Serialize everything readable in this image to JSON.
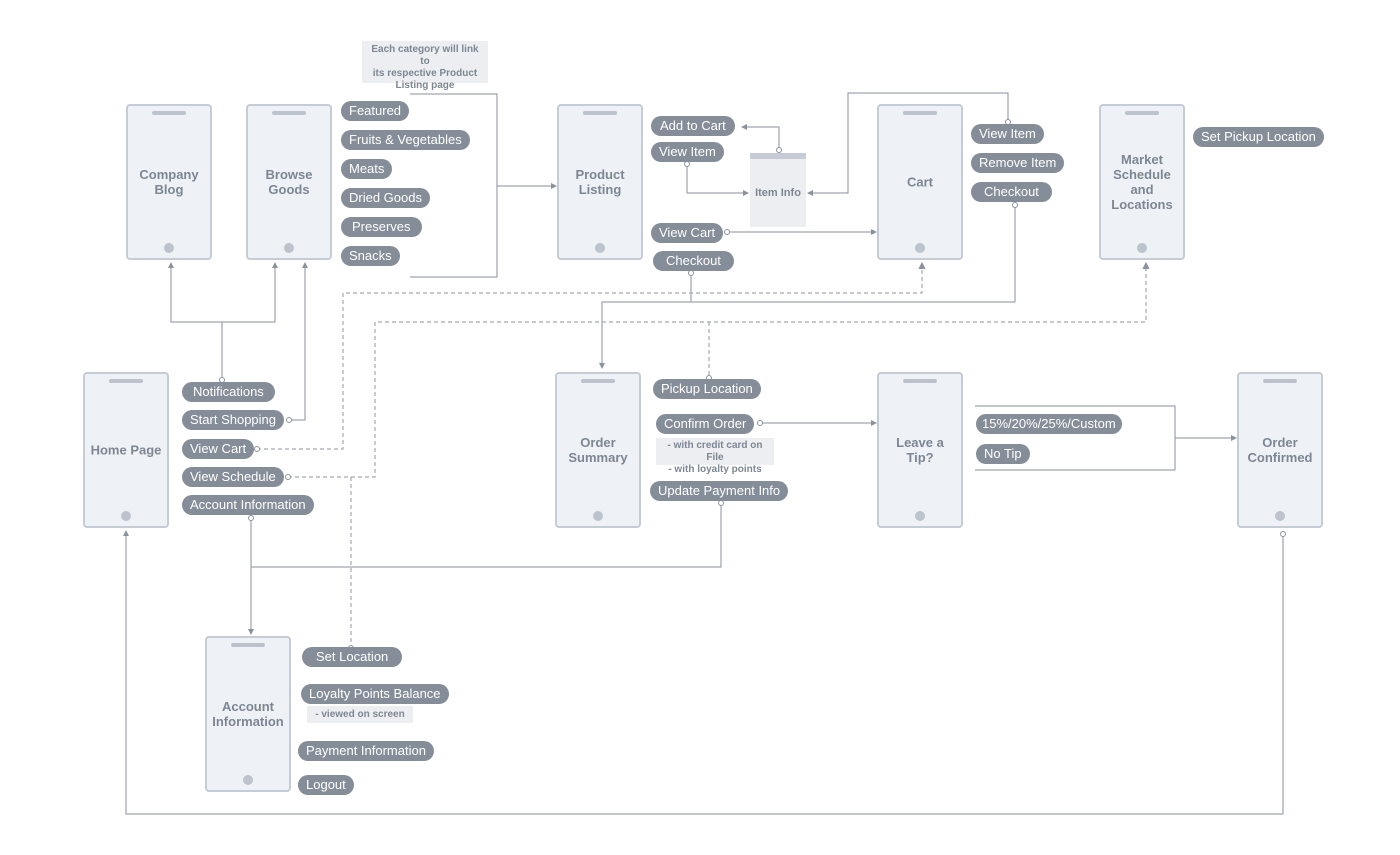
{
  "diagram": {
    "type": "app-flow / wireframe sitemap",
    "colors": {
      "screen_bg": "#eef1f5",
      "screen_border": "#c6ccd6",
      "pill_bg": "#858d98",
      "pill_text": "#ffffff",
      "connector": "#8a929c",
      "note_bg": "#eceef1"
    }
  },
  "notes": {
    "category_note": "Each category will link to\nits respective Product\nListing page",
    "confirm_order_note": "- with credit card on File\n- with loyalty points",
    "loyalty_note": "- viewed on screen"
  },
  "screens": {
    "company_blog": "Company\nBlog",
    "browse_goods": "Browse\nGoods",
    "product_listing": "Product\nListing",
    "item_info": "Item Info",
    "cart": "Cart",
    "market_schedule": "Market\nSchedule\nand\nLocations",
    "home_page": "Home Page",
    "order_summary": "Order\nSummary",
    "leave_tip": "Leave a\nTip?",
    "order_confirmed": "Order\nConfirmed",
    "account_information": "Account\nInformation"
  },
  "actions": {
    "categories": [
      "Featured",
      "Fruits & Vegetables",
      "Meats",
      "Dried Goods",
      "Preserves",
      "Snacks"
    ],
    "product_listing": [
      "Add to Cart",
      "View Item",
      "View Cart",
      "Checkout"
    ],
    "cart": [
      "View Item",
      "Remove Item",
      "Checkout"
    ],
    "market": [
      "Set Pickup Location"
    ],
    "home": [
      "Notifications",
      "Start Shopping",
      "View Cart",
      "View Schedule",
      "Account Information"
    ],
    "order_summary": [
      "Pickup Location",
      "Confirm Order",
      "Update Payment Info"
    ],
    "tip": [
      "15%/20%/25%/Custom",
      "No Tip"
    ],
    "account": [
      "Set Location",
      "Loyalty Points Balance",
      "Payment Information",
      "Logout"
    ]
  }
}
